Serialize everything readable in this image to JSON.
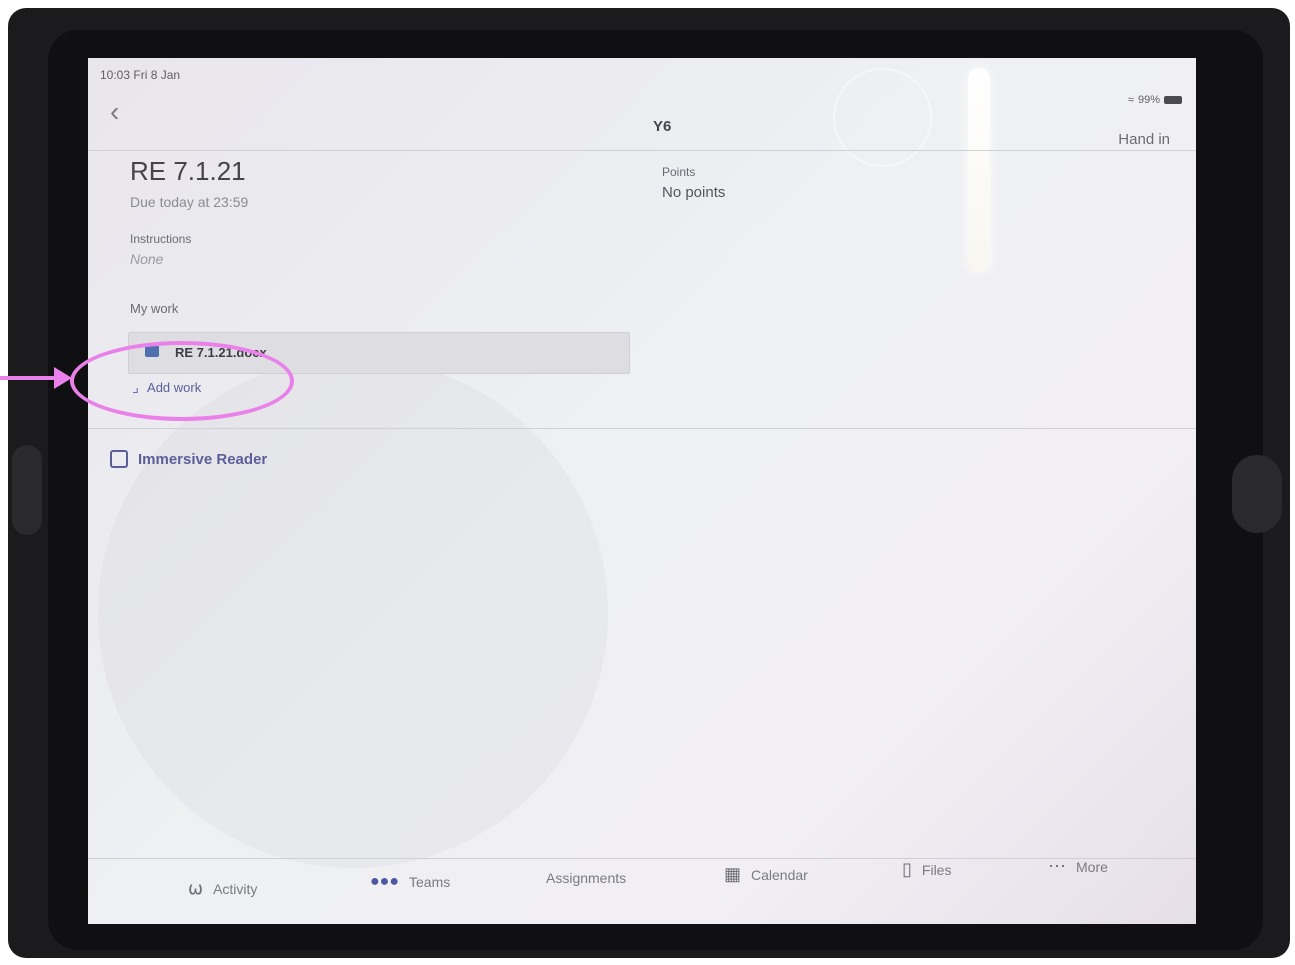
{
  "status_bar": {
    "time_date": "10:03  Fri 8 Jan",
    "battery": "99%"
  },
  "header": {
    "title": "Y6",
    "hand_in_label": "Hand in"
  },
  "assignment": {
    "title": "RE 7.1.21",
    "due": "Due today at 23:59",
    "instructions_label": "Instructions",
    "instructions_value": "None",
    "points_label": "Points",
    "points_value": "No points",
    "my_work_label": "My work",
    "file_name": "RE 7.1.21.docx",
    "add_work_label": "Add work"
  },
  "immersive_reader_label": "Immersive Reader",
  "tabs": [
    {
      "label": "Activity",
      "icon": "bell-icon"
    },
    {
      "label": "Teams",
      "icon": "teams-icon"
    },
    {
      "label": "Assignments",
      "icon": ""
    },
    {
      "label": "Calendar",
      "icon": "calendar-icon"
    },
    {
      "label": "Files",
      "icon": "file-icon"
    },
    {
      "label": "More",
      "icon": "ellipsis-icon"
    }
  ],
  "colors": {
    "accent": "#5a5f9a",
    "annotation": "#ea80ea"
  }
}
